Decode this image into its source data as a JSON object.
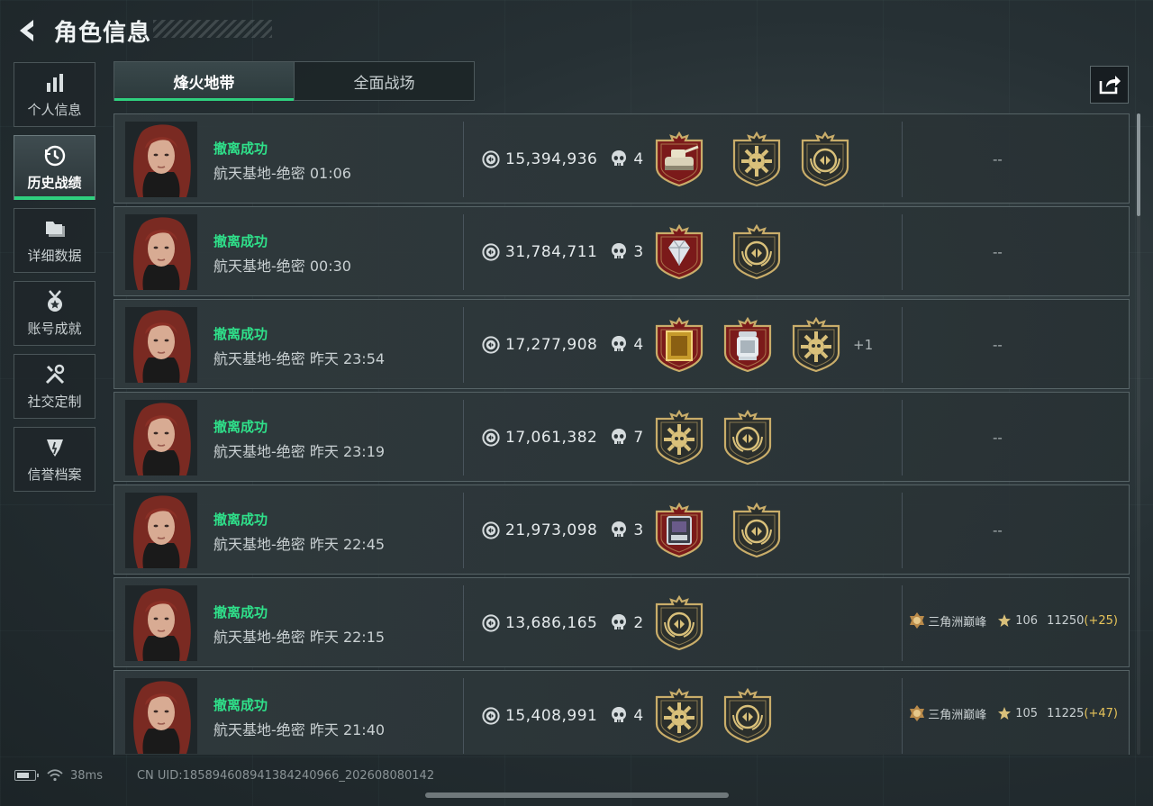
{
  "header": {
    "title": "角色信息"
  },
  "sidebar": {
    "items": [
      {
        "label": "个人信息",
        "icon": "bar-chart-icon",
        "active": false
      },
      {
        "label": "历史战绩",
        "icon": "history-clock-icon",
        "active": true
      },
      {
        "label": "详细数据",
        "icon": "folder-icon",
        "active": false
      },
      {
        "label": "账号成就",
        "icon": "medal-icon",
        "active": false
      },
      {
        "label": "社交定制",
        "icon": "tools-icon",
        "active": false
      },
      {
        "label": "信誉档案",
        "icon": "shield-icon",
        "active": false
      }
    ]
  },
  "tabs": [
    {
      "label": "烽火地带",
      "active": true
    },
    {
      "label": "全面战场",
      "active": false
    }
  ],
  "share": {
    "icon": "share-icon"
  },
  "records": [
    {
      "status": "撤离成功",
      "map_time": "航天基地-绝密 01:06",
      "value": "15,394,936",
      "kills": "4",
      "badges": [
        "tank-badge",
        "skull-star-badge",
        "emblem-badge"
      ],
      "more": "",
      "right": "--"
    },
    {
      "status": "撤离成功",
      "map_time": "航天基地-绝密 00:30",
      "value": "31,784,711",
      "kills": "3",
      "badges": [
        "diamond-badge",
        "emblem-badge"
      ],
      "more": "",
      "right": "--"
    },
    {
      "status": "撤离成功",
      "map_time": "航天基地-绝密 昨天 23:54",
      "value": "17,277,908",
      "kills": "4",
      "badges": [
        "gold-frame-badge",
        "lantern-badge",
        "skull-star-badge"
      ],
      "more": "+1",
      "right": "--"
    },
    {
      "status": "撤离成功",
      "map_time": "航天基地-绝密 昨天 23:19",
      "value": "17,061,382",
      "kills": "7",
      "badges": [
        "skull-star-badge",
        "emblem-badge"
      ],
      "more": "",
      "right": "--"
    },
    {
      "status": "撤离成功",
      "map_time": "航天基地-绝密 昨天 22:45",
      "value": "21,973,098",
      "kills": "3",
      "badges": [
        "device-badge",
        "emblem-badge"
      ],
      "more": "",
      "right": "--"
    },
    {
      "status": "撤离成功",
      "map_time": "航天基地-绝密 昨天 22:15",
      "value": "13,686,165",
      "kills": "2",
      "badges": [
        "emblem-badge"
      ],
      "more": "",
      "right": "",
      "rank": {
        "name": "三角洲巅峰",
        "stars": "106",
        "score": "11250",
        "delta": "(+25)"
      }
    },
    {
      "status": "撤离成功",
      "map_time": "航天基地-绝密 昨天 21:40",
      "value": "15,408,991",
      "kills": "4",
      "badges": [
        "skull-star-badge",
        "emblem-badge"
      ],
      "more": "",
      "right": "",
      "rank": {
        "name": "三角洲巅峰",
        "stars": "105",
        "score": "11225",
        "delta": "(+47)"
      }
    }
  ],
  "footer": {
    "ping": "38ms",
    "uid": "CN UID:185894608941384240966_202608080142"
  },
  "colors": {
    "accent_green": "#2fe08a",
    "delta_gold": "#e8c45a",
    "badge_red": "#8a1c1c"
  }
}
